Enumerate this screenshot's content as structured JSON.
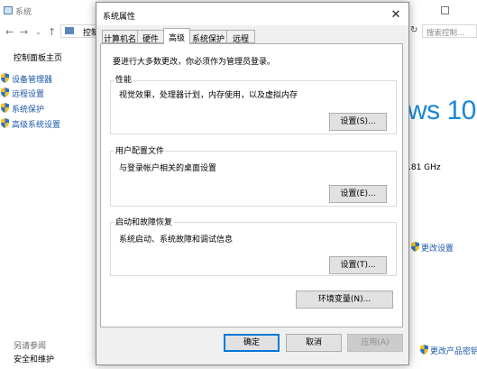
{
  "background_window": {
    "title": "系统",
    "breadcrumb": "控制",
    "search_placeholder": "搜索控制...",
    "sidebar": {
      "home": "控制面板主页",
      "links": [
        {
          "label": "设备管理器"
        },
        {
          "label": "远程设置"
        },
        {
          "label": "系统保护"
        },
        {
          "label": "高级系统设置"
        }
      ],
      "see_also": "另请参阅",
      "security": "安全和维护"
    },
    "windows_logo_text": "ws 10",
    "cpu_speed": ".81 GHz",
    "change_settings": "更改设置",
    "change_product_key": "更改产品密钥"
  },
  "dialog": {
    "title": "系统属性",
    "close": "✕",
    "tabs": [
      {
        "label": "计算机名",
        "active": false
      },
      {
        "label": "硬件",
        "active": false
      },
      {
        "label": "高级",
        "active": true
      },
      {
        "label": "系统保护",
        "active": false
      },
      {
        "label": "远程",
        "active": false
      }
    ],
    "admin_note": "要进行大多数更改，你必须作为管理员登录。",
    "performance": {
      "title": "性能",
      "desc": "视觉效果，处理器计划，内存使用，以及虚拟内存",
      "button": "设置(S)..."
    },
    "user_profiles": {
      "title": "用户配置文件",
      "desc": "与登录帐户相关的桌面设置",
      "button": "设置(E)..."
    },
    "startup_recovery": {
      "title": "启动和故障恢复",
      "desc": "系统启动、系统故障和调试信息",
      "button": "设置(T)..."
    },
    "env_vars_button": "环境变量(N)...",
    "ok": "确定",
    "cancel": "取消",
    "apply": "应用(A)"
  },
  "colors": {
    "accent": "#0078d7",
    "link": "#1a56a8",
    "win10_blue": "#1987d6"
  }
}
